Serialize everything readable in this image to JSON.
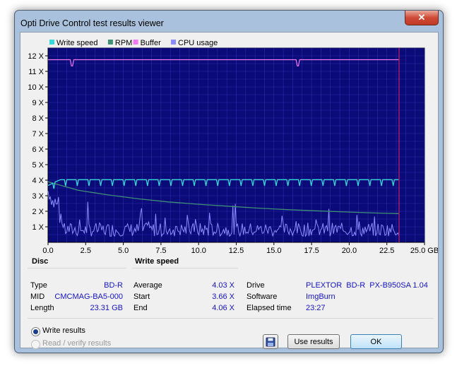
{
  "window": {
    "title": "Opti Drive Control test results viewer",
    "close_label": "✕"
  },
  "chart_data": {
    "type": "line",
    "legend": [
      "Write speed",
      "RPM",
      "Buffer",
      "CPU usage"
    ],
    "legend_colors": [
      "#37d8d8",
      "#3e8f76",
      "#f078f0",
      "#8c8cff"
    ],
    "x_ticks": [
      "0.0",
      "2.5",
      "5.0",
      "7.5",
      "10.0",
      "12.5",
      "15.0",
      "17.5",
      "20.0",
      "22.5",
      "25.0 GB"
    ],
    "y_ticks": [
      "1 X",
      "2 X",
      "3 X",
      "4 X",
      "5 X",
      "6 X",
      "7 X",
      "8 X",
      "9 X",
      "10 X",
      "11 X",
      "12 X"
    ],
    "xlim": [
      0,
      25
    ],
    "ylim": [
      0,
      12.5
    ],
    "end_marker_gb": 23.31,
    "grid": true,
    "series": [
      {
        "name": "Write speed",
        "x": [
          0,
          0.8,
          1.5,
          3,
          5,
          7.5,
          10,
          12.5,
          15,
          17.5,
          20,
          22,
          23.31
        ],
        "y": [
          3.66,
          3.98,
          4.03,
          4.03,
          4.03,
          4.03,
          4.03,
          4.03,
          4.03,
          4.03,
          4.03,
          4.03,
          4.06
        ]
      },
      {
        "name": "RPM",
        "x": [
          0,
          2,
          4,
          6,
          8,
          10,
          12,
          14,
          16,
          18,
          20,
          22,
          23.31
        ],
        "y": [
          3.9,
          3.35,
          3.05,
          2.8,
          2.6,
          2.45,
          2.32,
          2.2,
          2.1,
          2.02,
          1.95,
          1.88,
          1.85
        ]
      },
      {
        "name": "Buffer",
        "x": [
          0,
          23.31
        ],
        "y": [
          11.75,
          11.75
        ]
      },
      {
        "name": "CPU usage",
        "x": [
          0,
          2.5,
          5,
          7.5,
          10,
          12.5,
          15,
          17.5,
          20,
          22.5,
          23.31
        ],
        "y": [
          3.2,
          1.1,
          0.9,
          0.9,
          0.8,
          0.8,
          0.9,
          0.8,
          0.8,
          0.9,
          1.0
        ]
      }
    ]
  },
  "disc": {
    "header": "Disc",
    "rows": [
      {
        "label": "Type",
        "value": "BD-R"
      },
      {
        "label": "MID",
        "value": "CMCMAG-BA5-000"
      },
      {
        "label": "Length",
        "value": "23.31 GB"
      }
    ]
  },
  "write_speed": {
    "header": "Write speed",
    "rows": [
      {
        "label": "Average",
        "value": "4.03 X"
      },
      {
        "label": "Start",
        "value": "3.66 X"
      },
      {
        "label": "End",
        "value": "4.06 X"
      }
    ]
  },
  "info": {
    "rows": [
      {
        "label": "Drive",
        "value": "PLEXTOR  BD-R  PX-B950SA 1.04"
      },
      {
        "label": "Software",
        "value": "ImgBurn"
      },
      {
        "label": "Elapsed time",
        "value": "23:27"
      }
    ]
  },
  "options": {
    "write_results": "Write results",
    "read_verify_results": "Read / verify results",
    "selected": "Write results"
  },
  "buttons": {
    "save_icon": "floppy-disk",
    "use_results": "Use results",
    "ok": "OK"
  }
}
